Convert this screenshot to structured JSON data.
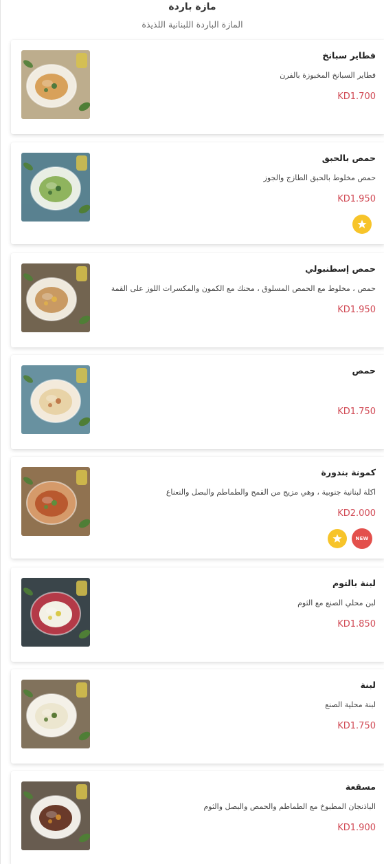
{
  "header": {
    "title": "مازة باردة",
    "subtitle": "المازة الباردة اللبنانية اللذيذة"
  },
  "items": [
    {
      "name": "فطاير سبانخ",
      "description": "فطاير السبانخ المخبوزة بالفرن",
      "price": "KD1.700",
      "badges": [],
      "image_icon": "spinach-pies-photo",
      "colors": {
        "bg": "#c9b896",
        "plate": "#f1ece1",
        "food": "#d8a15a",
        "accent": "#4e7a3e"
      }
    },
    {
      "name": "حمص بالحبق",
      "description": "حمص مخلوط بالحبق الطازج والجوز",
      "price": "KD1.950",
      "badges": [
        "star"
      ],
      "image_icon": "basil-hummus-photo",
      "colors": {
        "bg": "#5f8b9a",
        "plate": "#e9eee4",
        "food": "#8fb45e",
        "accent": "#3f6f37"
      }
    },
    {
      "name": "حمص إسطنبولي",
      "description": "حمص ، مخلوط مع الحمص المسلوق ، محنك مع الكمون والمكسرات اللوز على القمة",
      "price": "KD1.950",
      "badges": [],
      "image_icon": "istanbul-hummus-photo",
      "colors": {
        "bg": "#7a6b55",
        "plate": "#efe9dc",
        "food": "#c99a63",
        "accent": "#e0b24a"
      }
    },
    {
      "name": "حمص",
      "description": "",
      "price": "KD1.750",
      "badges": [],
      "image_icon": "hummus-photo",
      "colors": {
        "bg": "#6f9bab",
        "plate": "#f3eadb",
        "food": "#e8d3a7",
        "accent": "#c07a4a"
      }
    },
    {
      "name": "كمونة بندورة",
      "description": "اكلة لبنانية جنوبية ، وهي مزيج من القمح والطماطم والبصل والنعناع",
      "price": "KD2.000",
      "badges": [
        "new",
        "star"
      ],
      "image_icon": "tomato-kammouneh-photo",
      "colors": {
        "bg": "#9a7a55",
        "plate": "#d59a6a",
        "food": "#b9592f",
        "accent": "#5e8f3e"
      }
    },
    {
      "name": "لبنة بالتوم",
      "description": "لبن محلي الصنع مع الثوم",
      "price": "KD1.850",
      "badges": [],
      "image_icon": "labneh-garlic-photo",
      "colors": {
        "bg": "#3e4a4f",
        "plate": "#b43a48",
        "food": "#f3f1e6",
        "accent": "#d9c94a"
      }
    },
    {
      "name": "لبنة",
      "description": "لبنة محلية الصنع",
      "price": "KD1.750",
      "badges": [],
      "image_icon": "labneh-photo",
      "colors": {
        "bg": "#8a7a62",
        "plate": "#f4f1e8",
        "food": "#ece6cf",
        "accent": "#5a7a36"
      }
    },
    {
      "name": "مسقعة",
      "description": "الباذنجان المطبوخ مع الطماطم والحمص والبصل والثوم",
      "price": "KD1.900",
      "badges": [],
      "image_icon": "moussaka-photo",
      "colors": {
        "bg": "#6f6356",
        "plate": "#f0ede7",
        "food": "#6a3a2a",
        "accent": "#c9862e"
      }
    }
  ],
  "colors": {
    "price": "#d14a55",
    "star_badge": "#f7c42a",
    "new_badge": "#e3504c"
  },
  "badge_labels": {
    "new": "NEW"
  }
}
